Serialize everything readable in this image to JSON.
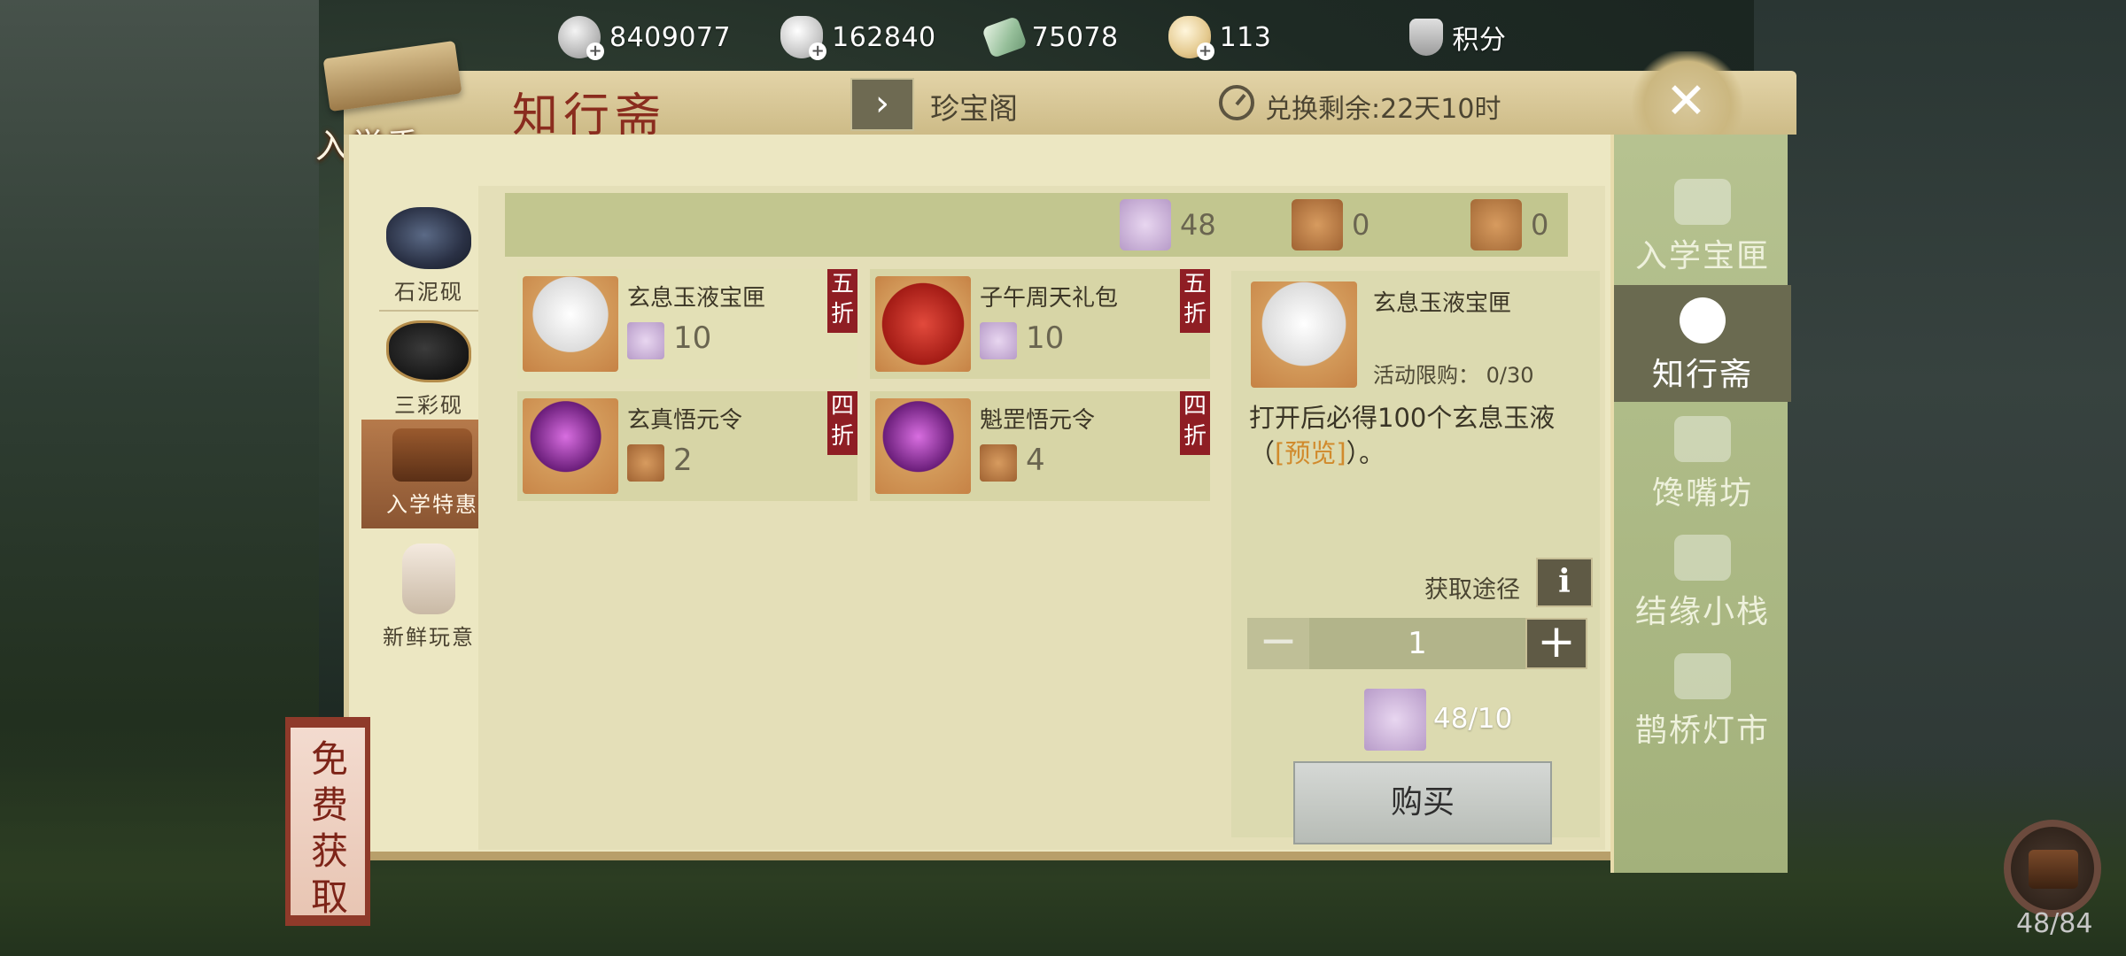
{
  "currencies": [
    {
      "icon": "coin-plus-icon",
      "value": "8409077"
    },
    {
      "icon": "silver-plus-icon",
      "value": "162840"
    },
    {
      "icon": "jade-plus-icon",
      "value": "75078"
    },
    {
      "icon": "ingot-plus-icon",
      "value": "113"
    },
    {
      "icon": "points-shield-icon",
      "value": "积分"
    }
  ],
  "header": {
    "season_badge": "入学季",
    "title": "知行斋",
    "jump_arrow": "›",
    "jump_label": "珍宝阁",
    "timer_label": "兑换剩余:22天10时",
    "close_glyph": "✕"
  },
  "left_categories": [
    {
      "label": "石泥砚",
      "icon": "inkstone-icon"
    },
    {
      "label": "三彩砚",
      "icon": "colored-inkstone-icon"
    },
    {
      "label": "入学特惠",
      "icon": "treasure-chest-icon",
      "active": true
    },
    {
      "label": "新鲜玩意",
      "icon": "toy-icon"
    }
  ],
  "free_obtain": "免费获取",
  "owned": [
    {
      "icon": "inkstone-token-icon",
      "value": "48"
    },
    {
      "icon": "rare-inkstone-token-icon",
      "value": "0"
    },
    {
      "icon": "costume-token-icon",
      "value": "0"
    }
  ],
  "goods": [
    {
      "name": "玄息玉液宝匣",
      "price": "10",
      "discount": "五折"
    },
    {
      "name": "子午周天礼包",
      "price": "10",
      "discount": "五折"
    },
    {
      "name": "玄真悟元令",
      "price": "2",
      "discount": "四折"
    },
    {
      "name": "魁罡悟元令",
      "price": "4",
      "discount": "四折"
    }
  ],
  "detail": {
    "name": "玄息玉液宝匣",
    "limit": "活动限购： 0/30",
    "desc_before": "打开后必得100个玄息玉液（",
    "preview": "[预览]",
    "desc_after": "）。",
    "source_label": "获取途径",
    "info_glyph": "i",
    "quantity": "1",
    "minus": "−",
    "plus": "+",
    "cost": "48/10",
    "buy_label": "购买"
  },
  "right_tabs": [
    {
      "label": "入学宝匣"
    },
    {
      "label": "知行斋",
      "active": true
    },
    {
      "label": "馋嘴坊"
    },
    {
      "label": "结缘小栈"
    },
    {
      "label": "鹊桥灯市"
    }
  ],
  "chest_count": "48/84"
}
